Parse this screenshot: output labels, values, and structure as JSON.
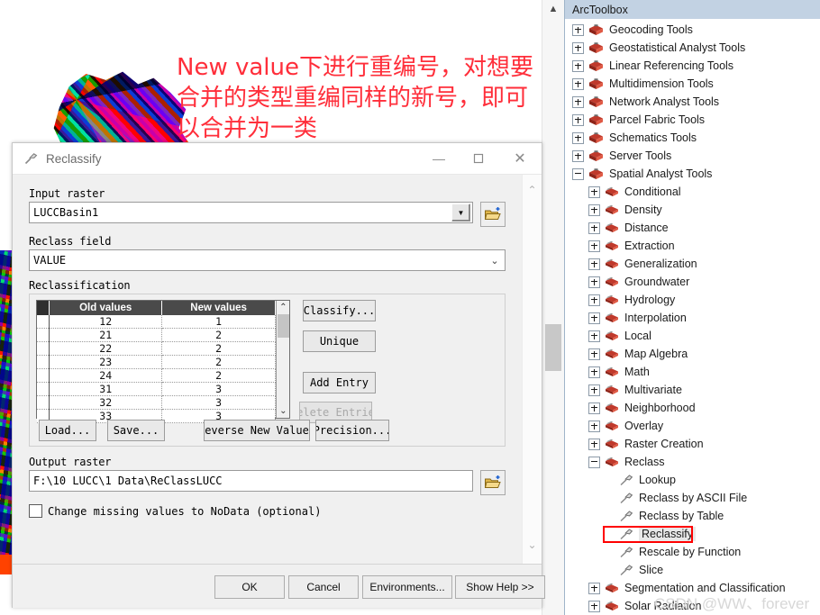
{
  "annotation": {
    "text": "New value下进行重编号，对想要\n合并的类型重编同样的新号，即可\n以合并为一类",
    "color": "#ff2e3a"
  },
  "dialog": {
    "title": "Reclassify",
    "title_icon": "hammer-tool-icon",
    "window_buttons": {
      "minimize": "—",
      "maximize": "▢",
      "close": "✕"
    },
    "input_raster": {
      "label": "Input raster",
      "value": "LUCCBasin1",
      "browse_icon": "open-folder-add-icon"
    },
    "reclass_field": {
      "label": "Reclass field",
      "value": "VALUE"
    },
    "reclassification": {
      "label": "Reclassification",
      "columns": [
        "Old values",
        "New values"
      ],
      "rows": [
        {
          "old": "12",
          "new": "1"
        },
        {
          "old": "21",
          "new": "2"
        },
        {
          "old": "22",
          "new": "2"
        },
        {
          "old": "23",
          "new": "2"
        },
        {
          "old": "24",
          "new": "2"
        },
        {
          "old": "31",
          "new": "3"
        },
        {
          "old": "32",
          "new": "3"
        },
        {
          "old": "33",
          "new": "3"
        }
      ],
      "side_buttons": [
        {
          "label": "Classify...",
          "disabled": false
        },
        {
          "label": "Unique",
          "disabled": false
        },
        {
          "label": "Add Entry",
          "disabled": false
        },
        {
          "label": "Delete Entries",
          "disabled": true
        }
      ],
      "bottom_buttons": [
        {
          "label": "Load..."
        },
        {
          "label": "Save..."
        },
        {
          "label": "Reverse New Values"
        },
        {
          "label": "Precision..."
        }
      ]
    },
    "output_raster": {
      "label": "Output raster",
      "value": "F:\\10 LUCC\\1 Data\\ReClassLUCC",
      "browse_icon": "open-folder-add-icon"
    },
    "change_missing": {
      "label": "Change missing values to NoData (optional)",
      "checked": false
    },
    "footer_buttons": [
      {
        "label": "OK"
      },
      {
        "label": "Cancel"
      },
      {
        "label": "Environments..."
      },
      {
        "label": "Show Help >>"
      }
    ]
  },
  "toolbox": {
    "header": "ArcToolbox",
    "items": [
      {
        "label": "Geocoding Tools",
        "level": 1,
        "icon": "toolbox-icon",
        "expander": "plus"
      },
      {
        "label": "Geostatistical Analyst Tools",
        "level": 1,
        "icon": "toolbox-icon",
        "expander": "plus"
      },
      {
        "label": "Linear Referencing Tools",
        "level": 1,
        "icon": "toolbox-icon",
        "expander": "plus"
      },
      {
        "label": "Multidimension Tools",
        "level": 1,
        "icon": "toolbox-icon",
        "expander": "plus"
      },
      {
        "label": "Network Analyst Tools",
        "level": 1,
        "icon": "toolbox-icon",
        "expander": "plus"
      },
      {
        "label": "Parcel Fabric Tools",
        "level": 1,
        "icon": "toolbox-icon",
        "expander": "plus"
      },
      {
        "label": "Schematics Tools",
        "level": 1,
        "icon": "toolbox-icon",
        "expander": "plus"
      },
      {
        "label": "Server Tools",
        "level": 1,
        "icon": "toolbox-icon",
        "expander": "plus"
      },
      {
        "label": "Spatial Analyst Tools",
        "level": 1,
        "icon": "toolbox-icon",
        "expander": "minus"
      },
      {
        "label": "Conditional",
        "level": 2,
        "icon": "toolset-icon",
        "expander": "plus"
      },
      {
        "label": "Density",
        "level": 2,
        "icon": "toolset-icon",
        "expander": "plus"
      },
      {
        "label": "Distance",
        "level": 2,
        "icon": "toolset-icon",
        "expander": "plus"
      },
      {
        "label": "Extraction",
        "level": 2,
        "icon": "toolset-icon",
        "expander": "plus"
      },
      {
        "label": "Generalization",
        "level": 2,
        "icon": "toolset-icon",
        "expander": "plus"
      },
      {
        "label": "Groundwater",
        "level": 2,
        "icon": "toolset-icon",
        "expander": "plus"
      },
      {
        "label": "Hydrology",
        "level": 2,
        "icon": "toolset-icon",
        "expander": "plus"
      },
      {
        "label": "Interpolation",
        "level": 2,
        "icon": "toolset-icon",
        "expander": "plus"
      },
      {
        "label": "Local",
        "level": 2,
        "icon": "toolset-icon",
        "expander": "plus"
      },
      {
        "label": "Map Algebra",
        "level": 2,
        "icon": "toolset-icon",
        "expander": "plus"
      },
      {
        "label": "Math",
        "level": 2,
        "icon": "toolset-icon",
        "expander": "plus"
      },
      {
        "label": "Multivariate",
        "level": 2,
        "icon": "toolset-icon",
        "expander": "plus"
      },
      {
        "label": "Neighborhood",
        "level": 2,
        "icon": "toolset-icon",
        "expander": "plus"
      },
      {
        "label": "Overlay",
        "level": 2,
        "icon": "toolset-icon",
        "expander": "plus"
      },
      {
        "label": "Raster Creation",
        "level": 2,
        "icon": "toolset-icon",
        "expander": "plus"
      },
      {
        "label": "Reclass",
        "level": 2,
        "icon": "toolset-icon",
        "expander": "minus"
      },
      {
        "label": "Lookup",
        "level": 3,
        "icon": "hammer-tool-icon",
        "expander": "none"
      },
      {
        "label": "Reclass by ASCII File",
        "level": 3,
        "icon": "hammer-tool-icon",
        "expander": "none"
      },
      {
        "label": "Reclass by Table",
        "level": 3,
        "icon": "hammer-tool-icon",
        "expander": "none"
      },
      {
        "label": "Reclassify",
        "level": 3,
        "icon": "hammer-tool-icon",
        "expander": "none",
        "highlight": true
      },
      {
        "label": "Rescale by Function",
        "level": 3,
        "icon": "hammer-tool-icon",
        "expander": "none"
      },
      {
        "label": "Slice",
        "level": 3,
        "icon": "hammer-tool-icon",
        "expander": "none"
      },
      {
        "label": "Segmentation and Classification",
        "level": 2,
        "icon": "toolset-icon",
        "expander": "plus"
      },
      {
        "label": "Solar Radiation",
        "level": 2,
        "icon": "toolset-icon",
        "expander": "plus"
      }
    ],
    "highlight_color": "#ff0000"
  },
  "watermark": "CSDN @WW、forever"
}
